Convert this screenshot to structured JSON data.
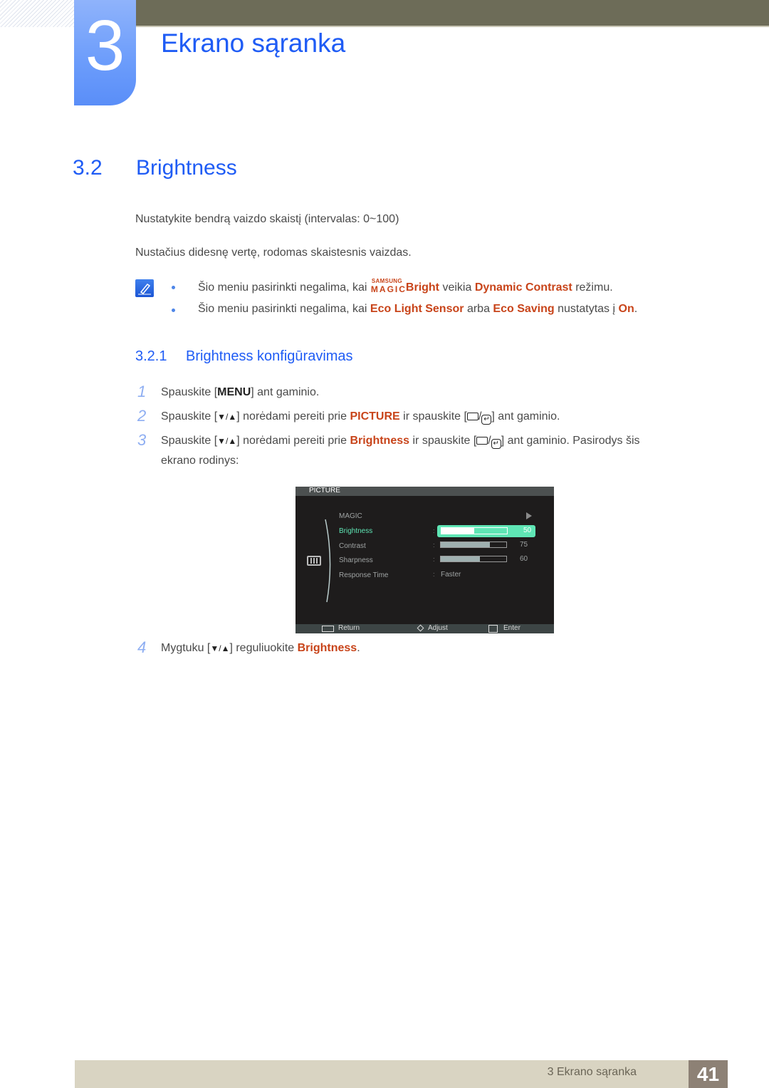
{
  "header": {
    "chapter_number": "3",
    "chapter_title": "Ekrano sąranka"
  },
  "section": {
    "number": "3.2",
    "title": "Brightness",
    "paragraphs": [
      "Nustatykite bendrą vaizdo skaistį (intervalas: 0~100)",
      "Nustačius didesnę vertę, rodomas skaistesnis vaizdas."
    ],
    "notes": [
      {
        "prefix": "Šio meniu pasirinkti negalima, kai",
        "logo_top": "SAMSUNG",
        "logo_bottom": "MAGIC",
        "hl1": "Bright",
        "mid": "veikia",
        "hl2": "Dynamic Contrast",
        "suffix": "režimu."
      },
      {
        "prefix": "Šio meniu pasirinkti negalima, kai",
        "hl1": "Eco Light Sensor",
        "mid": "arba",
        "hl2": "Eco Saving",
        "mid2": "nustatytas į",
        "hl3": "On",
        "suffix": "."
      }
    ]
  },
  "subsection": {
    "number": "3.2.1",
    "title": "Brightness konfigūravimas"
  },
  "steps": [
    {
      "num": "1",
      "pre": "Spauskite [",
      "key": "MENU",
      "post": "] ant gaminio."
    },
    {
      "num": "2",
      "pre": "Spauskite [",
      "key": "▼/▲",
      "mid": "] norėdami pereiti prie",
      "hl": "PICTURE",
      "mid2": "ir spauskite [",
      "post": "] ant gaminio."
    },
    {
      "num": "3",
      "pre": "Spauskite [",
      "key": "▼/▲",
      "mid": "] norėdami pereiti prie",
      "hl": "Brightness",
      "mid2": "ir spauskite [",
      "post": "] ant gaminio. Pasirodys šis",
      "line2": "ekrano rodinys:"
    },
    {
      "num": "4",
      "pre": "Mygtuku [",
      "key": "▼/▲",
      "mid": "] reguliuokite",
      "hl": "Brightness",
      "post": "."
    }
  ],
  "osd": {
    "title": "PICTURE",
    "items": [
      {
        "label": "MAGIC",
        "type": "submenu"
      },
      {
        "label": "Brightness",
        "value": 50,
        "display": "50",
        "selected": true
      },
      {
        "label": "Contrast",
        "value": 75,
        "display": "75"
      },
      {
        "label": "Sharpness",
        "value": 60,
        "display": "60"
      },
      {
        "label": "Response Time",
        "text_value": "Faster"
      }
    ],
    "footer": {
      "return": "Return",
      "adjust": "Adjust",
      "enter": "Enter"
    }
  },
  "footer": {
    "chapter_label": "3 Ekrano sąranka",
    "page_number": "41"
  },
  "colors": {
    "heading_blue": "#1f5cf5",
    "highlight_orange": "#c8441a",
    "osd_accent": "#5fe6b5",
    "header_band": "#6d6c58",
    "footer_band": "#d9d4c2",
    "page_box": "#8d8175"
  }
}
